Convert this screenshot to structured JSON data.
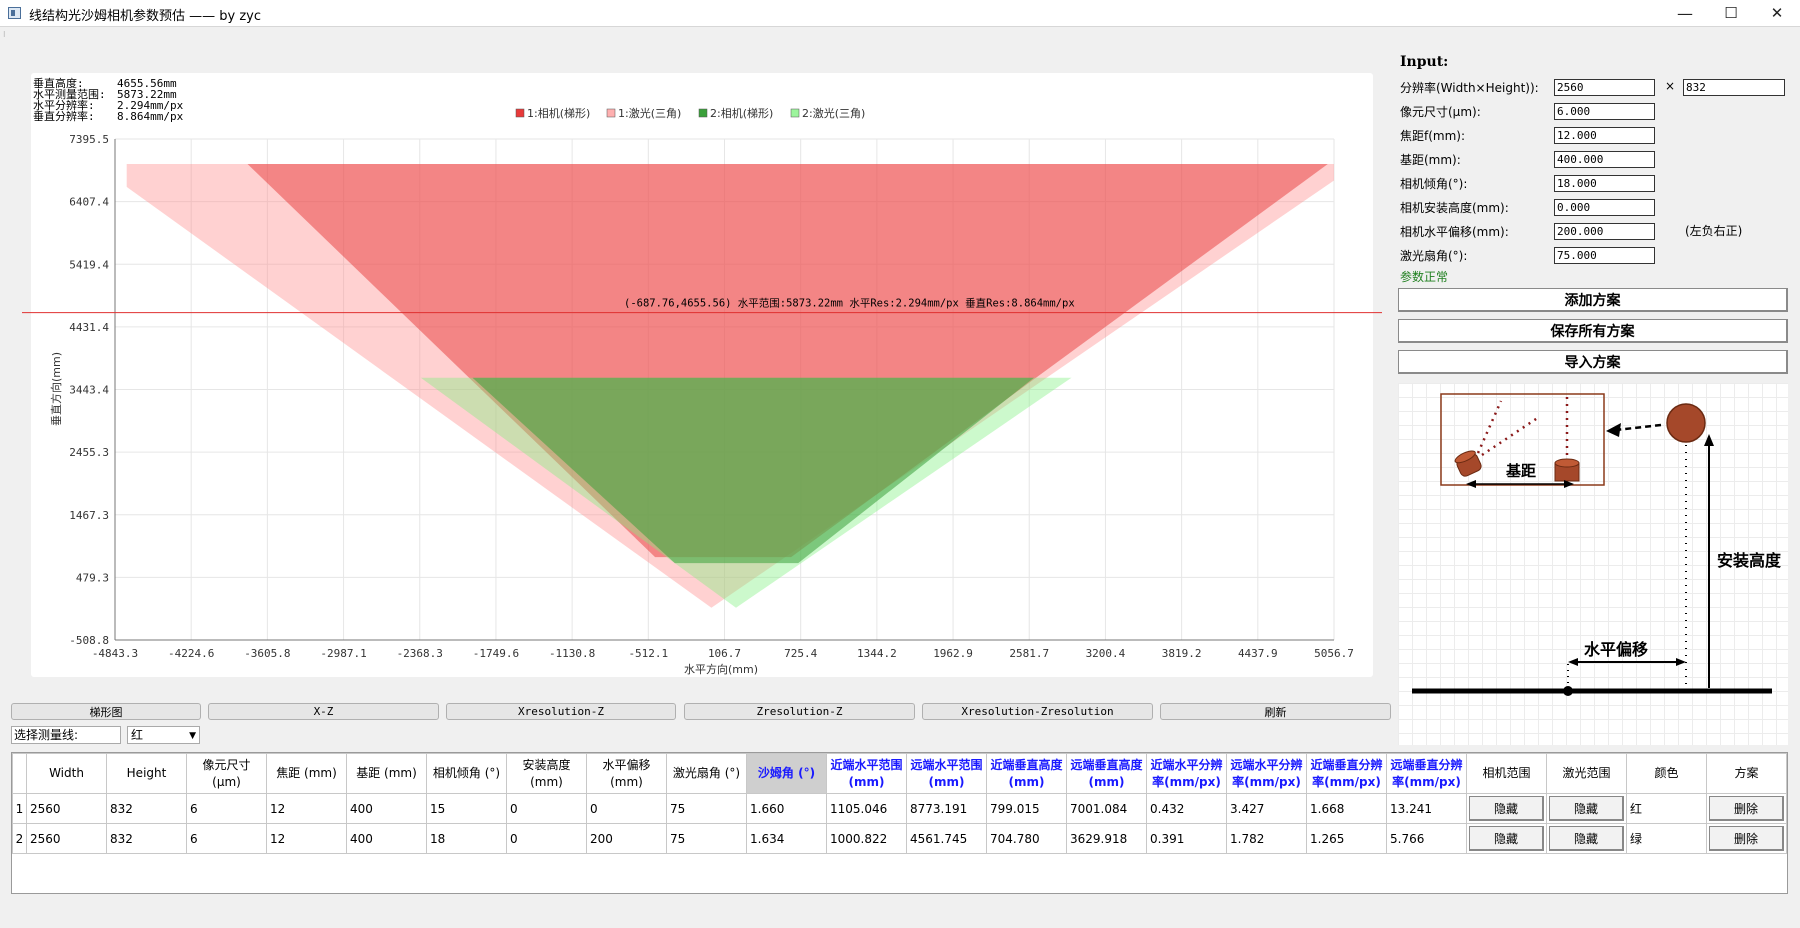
{
  "window": {
    "title": "线结构光沙姆相机参数预估 —— by zyc",
    "minimize_icon": "minimize-icon",
    "maximize_icon": "maximize-icon",
    "close_icon": "close-icon"
  },
  "chart_data": {
    "type": "area",
    "title": "",
    "xlabel": "水平方向(mm)",
    "ylabel": "垂直方向(mm)",
    "xlim": [
      -4843.3,
      5056.7
    ],
    "ylim": [
      -508.8,
      7395.5
    ],
    "x_ticks": [
      "-4843.3",
      "-4224.6",
      "-3605.8",
      "-2987.1",
      "-2368.3",
      "-1749.6",
      "-1130.8",
      "-512.1",
      "106.7",
      "725.4",
      "1344.2",
      "1962.9",
      "2581.7",
      "3200.4",
      "3819.2",
      "4437.9",
      "5056.7"
    ],
    "y_ticks": [
      "7395.5",
      "6407.4",
      "5419.4",
      "4431.4",
      "3443.4",
      "2455.3",
      "1467.3",
      "479.3",
      "-508.8"
    ],
    "grid": true,
    "legend_position": "top-center",
    "legend": [
      {
        "label": "1:相机(梯形)",
        "color": "#e83a3a"
      },
      {
        "label": "1:激光(三角)",
        "color": "#ffb0b0"
      },
      {
        "label": "2:相机(梯形)",
        "color": "#3aa03a"
      },
      {
        "label": "2:激光(三角)",
        "color": "#9cf59c"
      }
    ],
    "series": [
      {
        "name": "1:相机(梯形)",
        "fill": "#e83a3a",
        "opacity": 0.5,
        "points": [
          [
            -3767.0,
            7001.1
          ],
          [
            5006.2,
            7001.1
          ],
          [
            647.9,
            799.0
          ],
          [
            -457.1,
            799.0
          ]
        ]
      },
      {
        "name": "1:激光(三角)",
        "fill": "#ff8c8c",
        "opacity": 0.4,
        "points": [
          [
            -4748.0,
            7001.1
          ],
          [
            5056.7,
            7001.1
          ],
          [
            5056.7,
            6740.0
          ],
          [
            0.0,
            0.0
          ],
          [
            -4748.0,
            6640.0
          ]
        ]
      },
      {
        "name": "2:相机(梯形)",
        "fill": "#3aa03a",
        "opacity": 0.55,
        "points": [
          [
            -1940.0,
            3629.9
          ],
          [
            2620.0,
            3629.9
          ],
          [
            705.0,
            704.8
          ],
          [
            -297.0,
            704.8
          ]
        ]
      },
      {
        "name": "2:激光(三角)",
        "fill": "#7ff07f",
        "opacity": 0.4,
        "points": [
          [
            -2360.0,
            3629.9
          ],
          [
            2925.0,
            3629.9
          ],
          [
            200.0,
            0.0
          ]
        ]
      }
    ],
    "summary": [
      {
        "label": "垂直高度:",
        "value": "4655.56mm"
      },
      {
        "label": "水平测量范围:",
        "value": "5873.22mm"
      },
      {
        "label": "水平分辨率:",
        "value": "2.294mm/px"
      },
      {
        "label": "垂直分辨率:",
        "value": "8.864mm/px"
      }
    ],
    "measure_line": {
      "y": 4655.56,
      "color": "#e03030",
      "annotation": "(-687.76,4655.56) 水平范围:5873.22mm 水平Res:2.294mm/px 垂直Res:8.864mm/px"
    }
  },
  "tabs": [
    "梯形图",
    "X-Z",
    "Xresolution-Z",
    "Zresolution-Z",
    "Xresolution-Zresolution",
    "刷新"
  ],
  "measure_select": {
    "label": "选择测量线:",
    "value": "红"
  },
  "input_panel": {
    "title": "Input:",
    "resolution_label": "分辨率(Width×Height)):",
    "width": "2560",
    "x_sep": "×",
    "height": "832",
    "params": [
      {
        "label": "像元尺寸(μm):",
        "value": "6.000"
      },
      {
        "label": "焦距f(mm):",
        "value": "12.000"
      },
      {
        "label": "基距(mm):",
        "value": "400.000"
      },
      {
        "label": "相机倾角(°):",
        "value": "18.000"
      },
      {
        "label": "相机安装高度(mm):",
        "value": "0.000"
      },
      {
        "label": "相机水平偏移(mm):",
        "value": "200.000"
      },
      {
        "label": "激光扇角(°):",
        "value": "75.000"
      }
    ],
    "offset_hint": "(左负右正)",
    "status": "参数正常",
    "status_color": "#208020",
    "buttons": [
      "添加方案",
      "保存所有方案",
      "导入方案"
    ]
  },
  "diagram": {
    "baseline_label": "基距",
    "height_label": "安装高度",
    "offset_label": "水平偏移"
  },
  "table": {
    "headers": [
      "Width",
      "Height",
      "像元尺寸 (μm)",
      "焦距 (mm)",
      "基距 (mm)",
      "相机倾角 (°)",
      "安装高度 (mm)",
      "水平偏移 (mm)",
      "激光扇角 (°)",
      "沙姆角 (°)",
      "近端水平范围 (mm)",
      "远端水平范围 (mm)",
      "近端垂直高度 (mm)",
      "远端垂直高度 (mm)",
      "近端水平分辨率(mm/px)",
      "远端水平分辨率(mm/px)",
      "近端垂直分辨率(mm/px)",
      "远端垂直分辨率(mm/px)",
      "相机范围",
      "激光范围",
      "颜色",
      "方案"
    ],
    "rows": [
      {
        "num": "1",
        "cells": [
          "2560",
          "832",
          "6",
          "12",
          "400",
          "15",
          "0",
          "0",
          "75",
          "1.660",
          "1105.046",
          "8773.191",
          "799.015",
          "7001.084",
          "0.432",
          "3.427",
          "1.668",
          "13.241"
        ],
        "camera_btn": "隐藏",
        "laser_btn": "隐藏",
        "color": "红",
        "delete_btn": "删除"
      },
      {
        "num": "2",
        "cells": [
          "2560",
          "832",
          "6",
          "12",
          "400",
          "18",
          "0",
          "200",
          "75",
          "1.634",
          "1000.822",
          "4561.745",
          "704.780",
          "3629.918",
          "0.391",
          "1.782",
          "1.265",
          "5.766"
        ],
        "camera_btn": "隐藏",
        "laser_btn": "隐藏",
        "color": "绿",
        "delete_btn": "删除"
      }
    ]
  }
}
